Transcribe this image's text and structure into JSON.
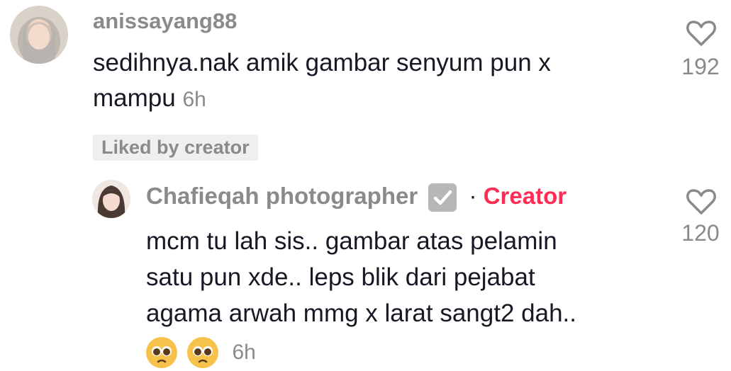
{
  "comment": {
    "username": "anissayang88",
    "text_line1": "sedihnya.nak amik gambar senyum pun x",
    "text_line2": "mampu",
    "time": "6h",
    "liked_badge": "Liked by creator",
    "likes": "192"
  },
  "reply": {
    "username": "Chafieqah photographer",
    "separator": "·",
    "creator_label": "Creator",
    "text_line1": "mcm tu lah sis.. gambar atas pelamin",
    "text_line2": "satu pun xde.. leps blik dari pejabat",
    "text_line3": "agama arwah mmg x larat sangt2 dah..",
    "time": "6h",
    "likes": "120"
  },
  "colors": {
    "accent": "#fe2c55",
    "muted": "#8a8a8a",
    "text": "#161823"
  },
  "icons": [
    "heart-icon",
    "verified-check-icon",
    "pleading-face-emoji"
  ]
}
